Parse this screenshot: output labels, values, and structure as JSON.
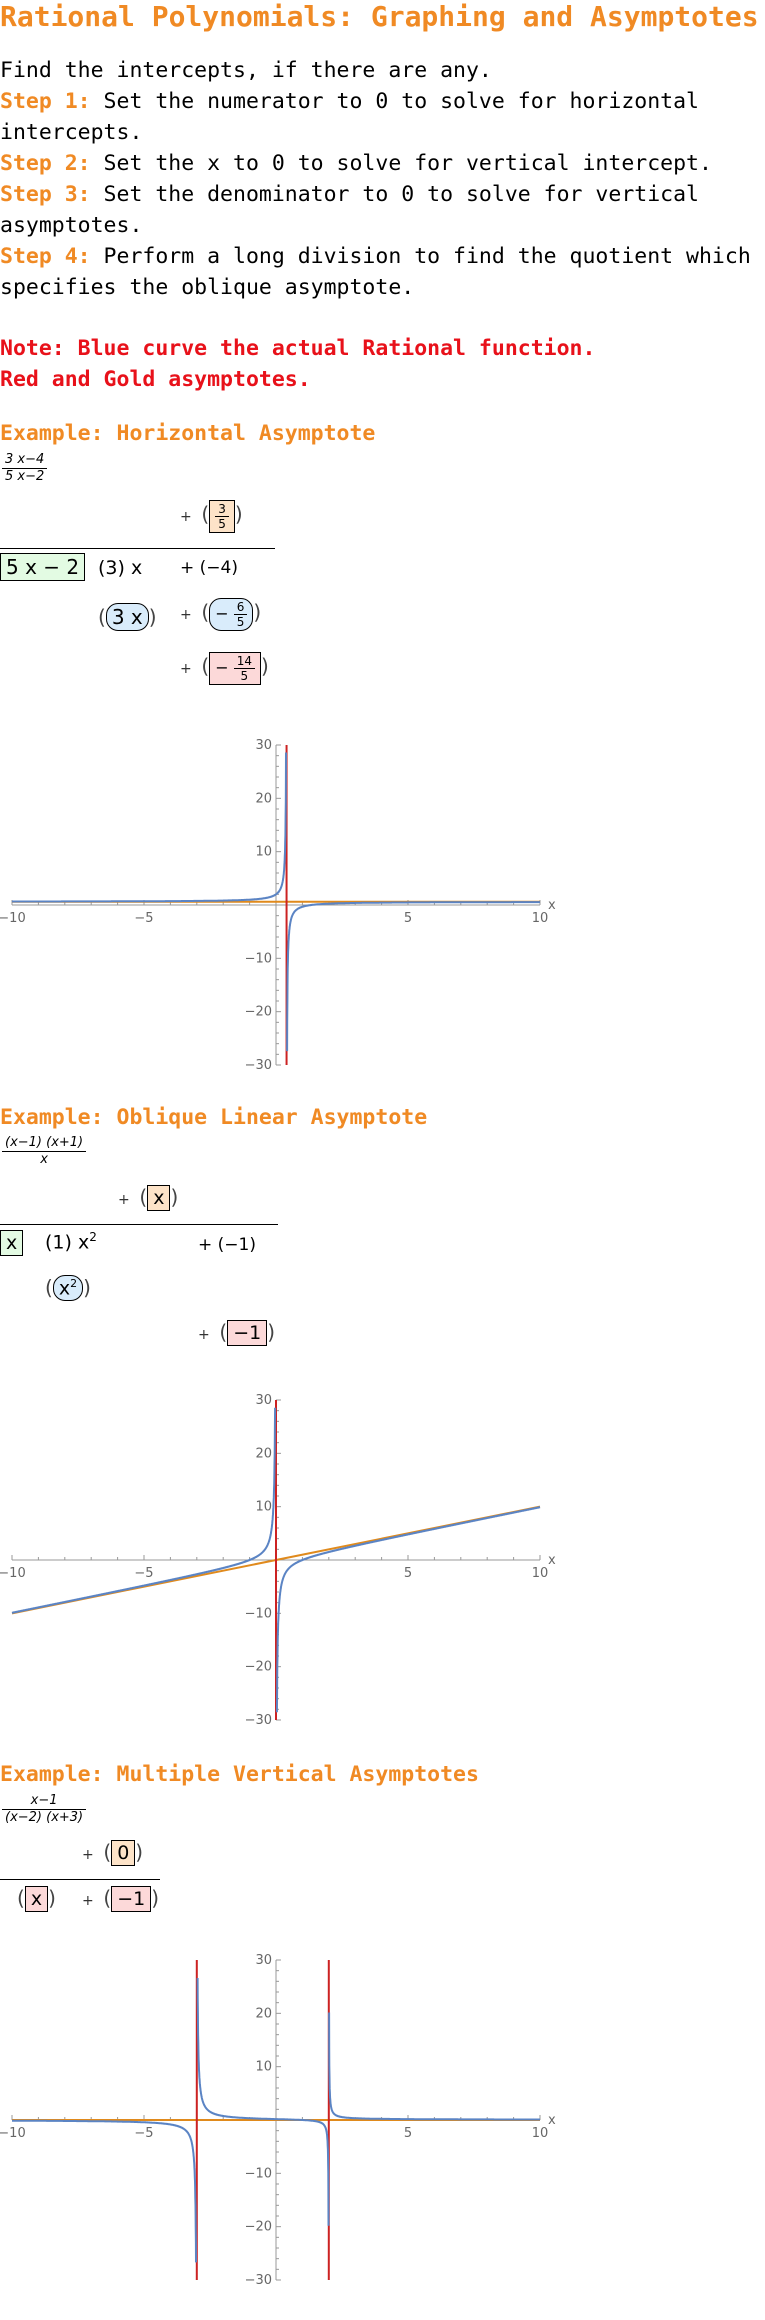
{
  "title": "Rational Polynomials: Graphing and Asymptotes",
  "intro": {
    "line1": "Find the intercepts, if there are any.",
    "steps": [
      {
        "label": "Step 1:",
        "text": " Set the numerator to 0 to solve for horizontal intercepts."
      },
      {
        "label": "Step 2:",
        "text": " Set the x to 0 to solve for vertical intercept."
      },
      {
        "label": "Step 3:",
        "text": " Set the denominator to 0 to solve for vertical asymptotes."
      },
      {
        "label": "Step 4:",
        "text": " Perform a long division to find the quotient which specifies the oblique asymptote."
      }
    ]
  },
  "note": {
    "line1": "Note: Blue curve the actual Rational function.",
    "line2": "Red and Gold asymptotes."
  },
  "colors": {
    "accent": "#f08a24",
    "note": "#e8111a",
    "curve": "#5b84c4",
    "vertical_asymptote": "#cc2222",
    "other_asymptote": "#e08a1c"
  },
  "examples": [
    {
      "heading": "Example: Horizontal Asymptote",
      "fraction": {
        "num": "3 x−4",
        "den": "5 x−2"
      },
      "quotient": {
        "num": "3",
        "den": "5"
      },
      "divisor": "5 x − 2",
      "dividend": [
        "(3) x",
        "+ (−4)"
      ],
      "sub1": "3 x",
      "sub2": {
        "sign": "−",
        "num": "6",
        "den": "5"
      },
      "remainder": {
        "sign": "−",
        "num": "14",
        "den": "5"
      }
    },
    {
      "heading": "Example: Oblique Linear Asymptote",
      "fraction": {
        "num": "(x−1) (x+1)",
        "den": "x"
      },
      "quotient": "x",
      "divisor": "x",
      "dividend_coef": "(1) x",
      "dividend_exp": "2",
      "dividend_const": "+ (−1)",
      "sub1_base": "x",
      "sub1_exp": "2",
      "remainder": "−1"
    },
    {
      "heading": "Example: Multiple Vertical Asymptotes",
      "fraction": {
        "num": "x−1",
        "den": "(x−2) (x+3)"
      },
      "quotient": "0",
      "divisor": "x",
      "remainder": "−1"
    }
  ],
  "chart_data": [
    {
      "type": "line",
      "function": "(3x-4)/(5x-2)",
      "xlim": [
        -10,
        10
      ],
      "ylim": [
        -30,
        30
      ],
      "xticks": [
        -10,
        -5,
        5,
        10
      ],
      "yticks": [
        -30,
        -20,
        -10,
        10,
        20,
        30
      ],
      "xlabel": "x",
      "vertical_asymptotes": [
        0.4
      ],
      "horizontal_asymptote": 0.6
    },
    {
      "type": "line",
      "function": "(x-1)(x+1)/x",
      "xlim": [
        -10,
        10
      ],
      "ylim": [
        -30,
        30
      ],
      "xticks": [
        -10,
        -5,
        5,
        10
      ],
      "yticks": [
        -30,
        -20,
        -10,
        10,
        20,
        30
      ],
      "xlabel": "x",
      "vertical_asymptotes": [
        0
      ],
      "oblique_asymptote": {
        "slope": 1,
        "intercept": 0
      }
    },
    {
      "type": "line",
      "function": "(x-1)/((x-2)(x+3))",
      "xlim": [
        -10,
        10
      ],
      "ylim": [
        -30,
        30
      ],
      "xticks": [
        -10,
        -5,
        5,
        10
      ],
      "yticks": [
        -30,
        -20,
        -10,
        10,
        20,
        30
      ],
      "xlabel": "x",
      "vertical_asymptotes": [
        -3,
        2
      ],
      "horizontal_asymptote": 0
    }
  ]
}
